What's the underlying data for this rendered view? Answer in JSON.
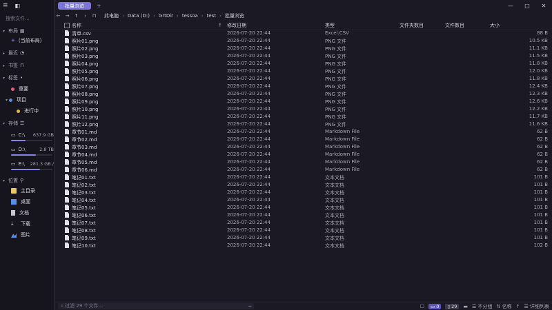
{
  "sidebar": {
    "search_placeholder": "搜索文件...",
    "sections": {
      "layout": "布局",
      "layout_item": "(当前布局)",
      "recent": "最近",
      "bookmarks": "书签",
      "tags": "标签",
      "tag_items": [
        {
          "label": "重要",
          "color": "#e0607a"
        },
        {
          "label": "项目",
          "color": "#5a8ee6"
        },
        {
          "label": "进行中",
          "color": "#e0b84a"
        }
      ],
      "storage": "存储",
      "drives": [
        {
          "label": "C:\\",
          "cap": "637.9 GB",
          "fill": 0.35
        },
        {
          "label": "D:\\",
          "cap": "2.8 TB",
          "fill": 0.6
        },
        {
          "label": "E:\\",
          "cap": "281.3 GB /",
          "fill": 0.7
        }
      ],
      "locations": "位置",
      "location_items": [
        {
          "label": "主目录",
          "icon": "folder-icon",
          "color": "#e8c86a"
        },
        {
          "label": "桌面",
          "icon": "desktop-icon",
          "color": "#5a8ee6"
        },
        {
          "label": "文档",
          "icon": "document-icon",
          "color": "#c9c6d4"
        },
        {
          "label": "下载",
          "icon": "download-icon",
          "color": "#c9c6d4"
        },
        {
          "label": "图片",
          "icon": "image-icon",
          "color": "#5a8ee6"
        }
      ]
    }
  },
  "tabs": [
    {
      "label": "批量浏览"
    }
  ],
  "path": [
    "此电脑",
    "Data (D:)",
    "GrtDir",
    "tessoa",
    "test",
    "批量浏览"
  ],
  "columns": {
    "name": "名称",
    "date": "修改日期",
    "type": "类型",
    "folders": "文件夹数目",
    "files": "文件数目",
    "size": "大小"
  },
  "files": [
    {
      "name": "清单.csv",
      "date": "2026-07-20 22:44",
      "type": "Excel.CSV",
      "size": "88 B"
    },
    {
      "name": "照片01.png",
      "date": "2026-07-20 22:44",
      "type": "PNG 文件",
      "size": "10.5 KB"
    },
    {
      "name": "照片02.png",
      "date": "2026-07-20 22:44",
      "type": "PNG 文件",
      "size": "11.1 KB"
    },
    {
      "name": "照片03.png",
      "date": "2026-07-20 22:44",
      "type": "PNG 文件",
      "size": "11.5 KB"
    },
    {
      "name": "照片04.png",
      "date": "2026-07-20 22:44",
      "type": "PNG 文件",
      "size": "11.8 KB"
    },
    {
      "name": "照片05.png",
      "date": "2026-07-20 22:44",
      "type": "PNG 文件",
      "size": "12.0 KB"
    },
    {
      "name": "照片06.png",
      "date": "2026-07-20 22:44",
      "type": "PNG 文件",
      "size": "11.8 KB"
    },
    {
      "name": "照片07.png",
      "date": "2026-07-20 22:44",
      "type": "PNG 文件",
      "size": "12.4 KB"
    },
    {
      "name": "照片08.png",
      "date": "2026-07-20 22:44",
      "type": "PNG 文件",
      "size": "12.3 KB"
    },
    {
      "name": "照片09.png",
      "date": "2026-07-20 22:44",
      "type": "PNG 文件",
      "size": "12.6 KB"
    },
    {
      "name": "照片10.png",
      "date": "2026-07-20 22:44",
      "type": "PNG 文件",
      "size": "12.2 KB"
    },
    {
      "name": "照片11.png",
      "date": "2026-07-20 22:44",
      "type": "PNG 文件",
      "size": "11.7 KB"
    },
    {
      "name": "照片12.png",
      "date": "2026-07-20 22:44",
      "type": "PNG 文件",
      "size": "11.6 KB"
    },
    {
      "name": "章节01.md",
      "date": "2026-07-20 22:44",
      "type": "Markdown File",
      "size": "62 B"
    },
    {
      "name": "章节02.md",
      "date": "2026-07-20 22:44",
      "type": "Markdown File",
      "size": "62 B"
    },
    {
      "name": "章节03.md",
      "date": "2026-07-20 22:44",
      "type": "Markdown File",
      "size": "62 B"
    },
    {
      "name": "章节04.md",
      "date": "2026-07-20 22:44",
      "type": "Markdown File",
      "size": "62 B"
    },
    {
      "name": "章节05.md",
      "date": "2026-07-20 22:44",
      "type": "Markdown File",
      "size": "62 B"
    },
    {
      "name": "章节06.md",
      "date": "2026-07-20 22:44",
      "type": "Markdown File",
      "size": "62 B"
    },
    {
      "name": "笔记01.txt",
      "date": "2026-07-20 22:44",
      "type": "文本文档",
      "size": "101 B"
    },
    {
      "name": "笔记02.txt",
      "date": "2026-07-20 22:44",
      "type": "文本文档",
      "size": "101 B"
    },
    {
      "name": "笔记03.txt",
      "date": "2026-07-20 22:44",
      "type": "文本文档",
      "size": "101 B"
    },
    {
      "name": "笔记04.txt",
      "date": "2026-07-20 22:44",
      "type": "文本文档",
      "size": "101 B"
    },
    {
      "name": "笔记05.txt",
      "date": "2026-07-20 22:44",
      "type": "文本文档",
      "size": "101 B"
    },
    {
      "name": "笔记06.txt",
      "date": "2026-07-20 22:44",
      "type": "文本文档",
      "size": "101 B"
    },
    {
      "name": "笔记07.txt",
      "date": "2026-07-20 22:44",
      "type": "文本文档",
      "size": "101 B"
    },
    {
      "name": "笔记08.txt",
      "date": "2026-07-20 22:44",
      "type": "文本文档",
      "size": "101 B"
    },
    {
      "name": "笔记09.txt",
      "date": "2026-07-20 22:44",
      "type": "文本文档",
      "size": "101 B"
    },
    {
      "name": "笔记10.txt",
      "date": "2026-07-20 22:44",
      "type": "文本文档",
      "size": "102 B"
    }
  ],
  "status": {
    "filter_placeholder": "过滤 29 个文件...",
    "folders": "0",
    "files": "29",
    "group": "不分组",
    "sort": "名称",
    "view": "详细列表"
  }
}
